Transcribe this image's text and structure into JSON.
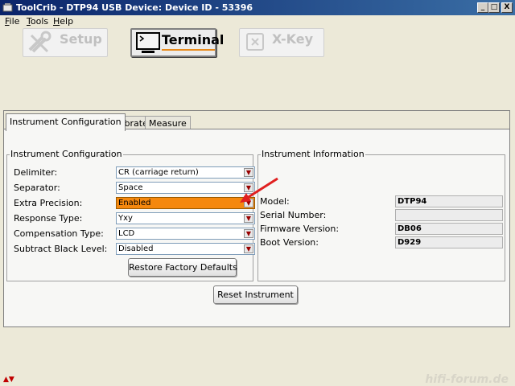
{
  "window": {
    "title": "ToolCrib - DTP94 USB Device: Device ID - 53396",
    "min": "_",
    "max": "□",
    "close": "X"
  },
  "menu": [
    "File",
    "Tools",
    "Help"
  ],
  "modes": {
    "setup": "Setup",
    "terminal": "Terminal",
    "xkey": "X-Key"
  },
  "tabs": [
    "Instrument Configuration",
    "Calibrate",
    "Measure"
  ],
  "config": {
    "legend": "Instrument Configuration",
    "rows": [
      {
        "label": "Delimiter:",
        "value": "CR (carriage return)"
      },
      {
        "label": "Separator:",
        "value": "Space"
      },
      {
        "label": "Extra Precision:",
        "value": "Enabled"
      },
      {
        "label": "Response Type:",
        "value": "Yxy"
      },
      {
        "label": "Compensation Type:",
        "value": "LCD"
      },
      {
        "label": "Subtract Black Level:",
        "value": "Disabled"
      }
    ],
    "restore_label": "Restore Factory Defaults"
  },
  "info": {
    "legend": "Instrument Information",
    "rows": [
      {
        "label": "Model:",
        "value": "DTP94"
      },
      {
        "label": "Serial Number:",
        "value": ""
      },
      {
        "label": "Firmware Version:",
        "value": "DB06"
      },
      {
        "label": "Boot Version:",
        "value": "D929"
      }
    ]
  },
  "reset_label": "Reset Instrument",
  "highlight_color": "#f5880e",
  "annotation_arrow_color": "#e02020",
  "watermark": "hifi-forum.de"
}
